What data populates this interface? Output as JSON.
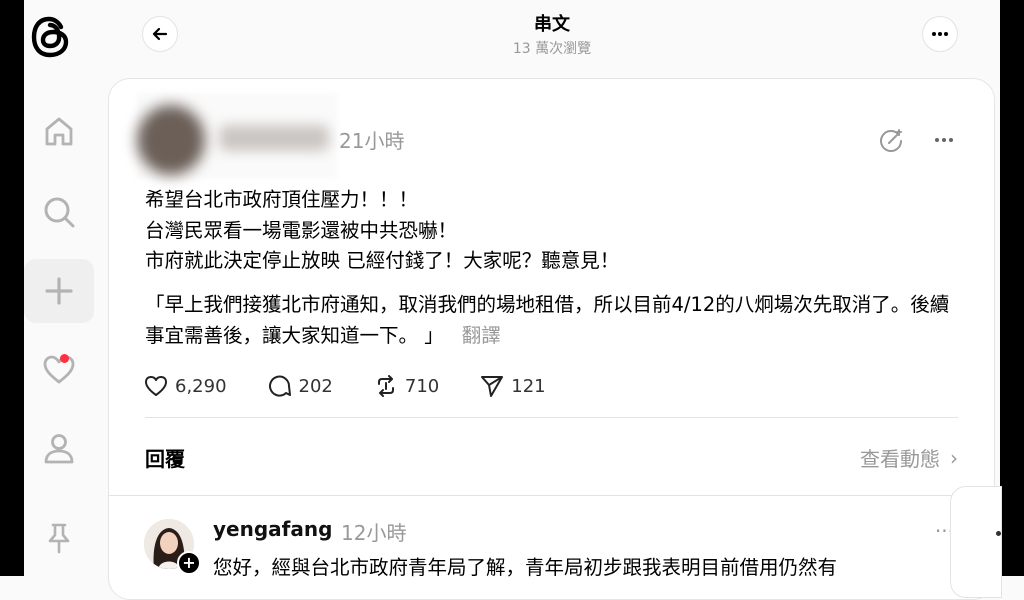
{
  "header": {
    "title": "串文",
    "subtitle": "13 萬次瀏覽"
  },
  "nav": {
    "items": [
      {
        "name": "home",
        "icon": "home-icon"
      },
      {
        "name": "search",
        "icon": "search-icon"
      },
      {
        "name": "create",
        "icon": "plus-icon"
      },
      {
        "name": "activity",
        "icon": "heart-icon",
        "has_notification": true
      },
      {
        "name": "profile",
        "icon": "person-icon"
      },
      {
        "name": "pinned",
        "icon": "pin-icon"
      }
    ]
  },
  "post": {
    "time": "21小時",
    "body": "希望台北市政府頂住壓力！！！\n台灣民眾看一場電影還被中共恐嚇！\n市府就此決定停止放映 已經付錢了！大家呢？聽意見！",
    "quote": "「早上我們接獲北市府通知，取消我們的場地租借，所以目前4/12的八炯場次先取消了。後續事宜需善後，讓大家知道一下。 」",
    "translate": "翻譯",
    "likes": "6,290",
    "comments": "202",
    "reposts": "710",
    "shares": "121"
  },
  "replies_section": {
    "label": "回覆",
    "activity_link": "查看動態"
  },
  "reply": {
    "username": "yengafang",
    "time": "12小時",
    "text": "您好，經與台北市政府青年局了解，青年局初步跟我表明目前借用仍然有"
  },
  "colors": {
    "accent_notification": "#ff3040",
    "muted_text": "#999999",
    "background": "#fafafa"
  }
}
